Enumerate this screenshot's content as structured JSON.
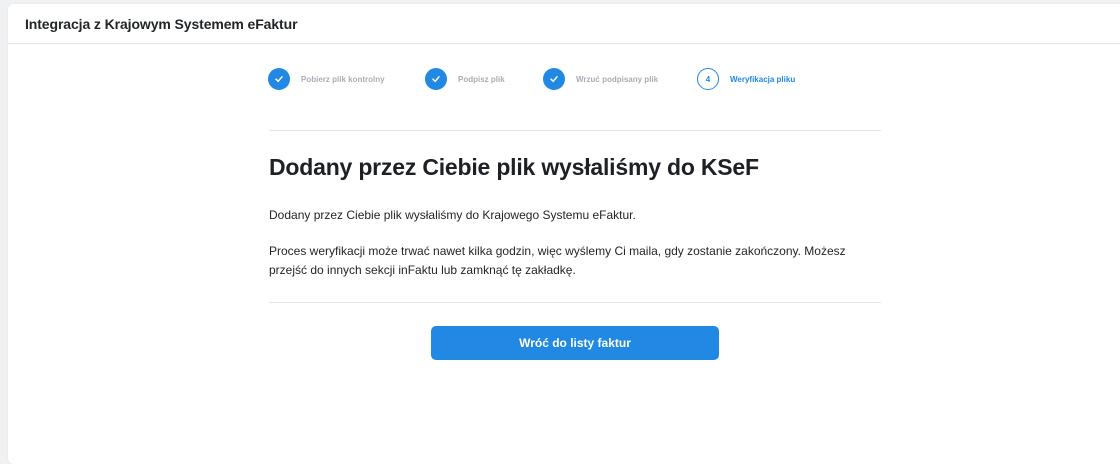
{
  "header": {
    "title": "Integracja z Krajowym Systemem eFaktur"
  },
  "steps": [
    {
      "label": "Pobierz plik kontrolny",
      "state": "done",
      "icon": "check-icon"
    },
    {
      "label": "Podpisz plik",
      "state": "done",
      "icon": "check-icon"
    },
    {
      "label": "Wrzuć podpisany plik",
      "state": "done",
      "icon": "check-icon"
    },
    {
      "label": "Weryfikacja pliku",
      "state": "active",
      "number": "4"
    }
  ],
  "main": {
    "heading": "Dodany przez Ciebie plik wysłaliśmy do KSeF",
    "paragraph1": "Dodany przez Ciebie plik wysłaliśmy do Krajowego Systemu eFaktur.",
    "paragraph2": "Proces weryfikacji może trwać nawet kilka godzin, więc wyślemy Ci maila, gdy zostanie zakończony. Możesz przejść do innych sekcji inFaktu lub zamknąć tę zakładkę."
  },
  "actions": {
    "back_label": "Wróć do listy faktur"
  },
  "colors": {
    "accent": "#2189e3",
    "muted_text": "#a9aeb5",
    "background": "#f0f1f3"
  }
}
